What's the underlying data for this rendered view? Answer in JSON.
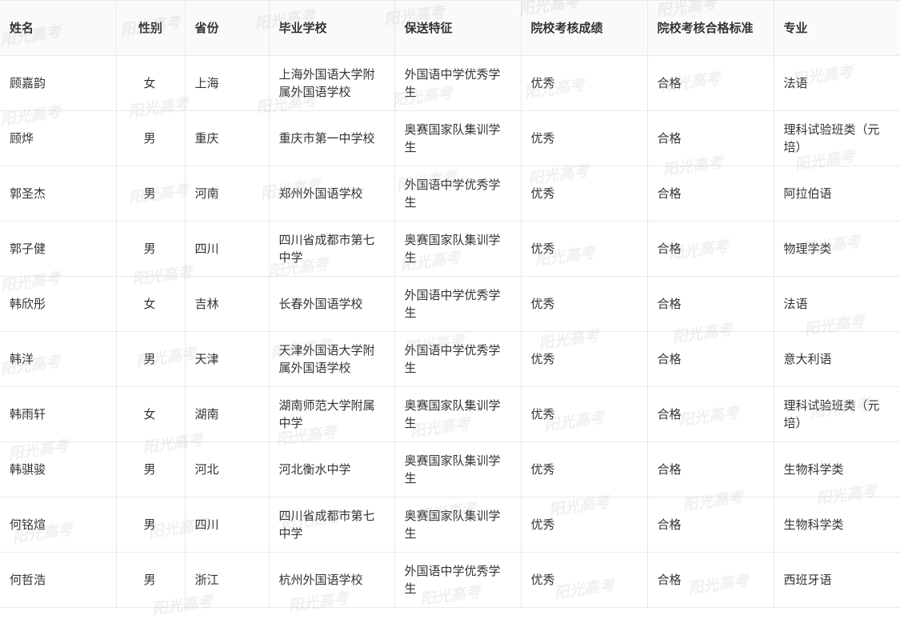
{
  "table": {
    "headers": [
      "姓名",
      "性别",
      "省份",
      "毕业学校",
      "保送特征",
      "院校考核成绩",
      "院校考核合格标准",
      "专业"
    ],
    "rows": [
      [
        "顾嘉韵",
        "女",
        "上海",
        "上海外国语大学附属外国语学校",
        "外国语中学优秀学生",
        "优秀",
        "合格",
        "法语"
      ],
      [
        "顾烨",
        "男",
        "重庆",
        "重庆市第一中学校",
        "奥赛国家队集训学生",
        "优秀",
        "合格",
        "理科试验班类（元培）"
      ],
      [
        "郭圣杰",
        "男",
        "河南",
        "郑州外国语学校",
        "外国语中学优秀学生",
        "优秀",
        "合格",
        "阿拉伯语"
      ],
      [
        "郭子健",
        "男",
        "四川",
        "四川省成都市第七中学",
        "奥赛国家队集训学生",
        "优秀",
        "合格",
        "物理学类"
      ],
      [
        "韩欣彤",
        "女",
        "吉林",
        "长春外国语学校",
        "外国语中学优秀学生",
        "优秀",
        "合格",
        "法语"
      ],
      [
        "韩洋",
        "男",
        "天津",
        "天津外国语大学附属外国语学校",
        "外国语中学优秀学生",
        "优秀",
        "合格",
        "意大利语"
      ],
      [
        "韩雨轩",
        "女",
        "湖南",
        "湖南师范大学附属中学",
        "奥赛国家队集训学生",
        "优秀",
        "合格",
        "理科试验班类（元培）"
      ],
      [
        "韩骐骏",
        "男",
        "河北",
        "河北衡水中学",
        "奥赛国家队集训学生",
        "优秀",
        "合格",
        "生物科学类"
      ],
      [
        "何铭煊",
        "男",
        "四川",
        "四川省成都市第七中学",
        "奥赛国家队集训学生",
        "优秀",
        "合格",
        "生物科学类"
      ],
      [
        "何哲浩",
        "男",
        "浙江",
        "杭州外国语学校",
        "外国语中学优秀学生",
        "优秀",
        "合格",
        "西班牙语"
      ]
    ]
  },
  "watermark": {
    "text": "阳光高考"
  }
}
